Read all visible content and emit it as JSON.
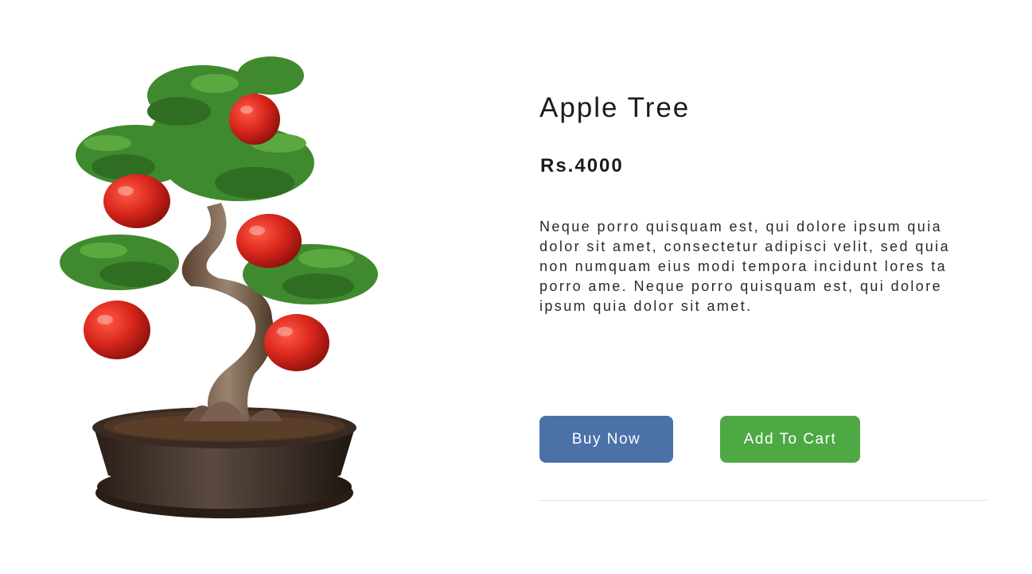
{
  "product": {
    "image_alt": "apple-bonsai-tree-image",
    "title": "Apple Tree",
    "price": "Rs.4000",
    "description": "Neque porro quisquam est, qui dolore ipsum quia dolor sit amet, consectetur adipisci velit, sed quia non numquam eius modi tempora incidunt lores ta porro ame. Neque porro quisquam est, qui dolore ipsum quia dolor sit amet."
  },
  "actions": {
    "buy_label": "Buy Now",
    "cart_label": "Add To Cart"
  },
  "colors": {
    "buy_button": "#4a71a8",
    "cart_button": "#4ea844",
    "text": "#1c1c1c",
    "apple": "#d9261c",
    "leaf": "#3f8a2e"
  }
}
